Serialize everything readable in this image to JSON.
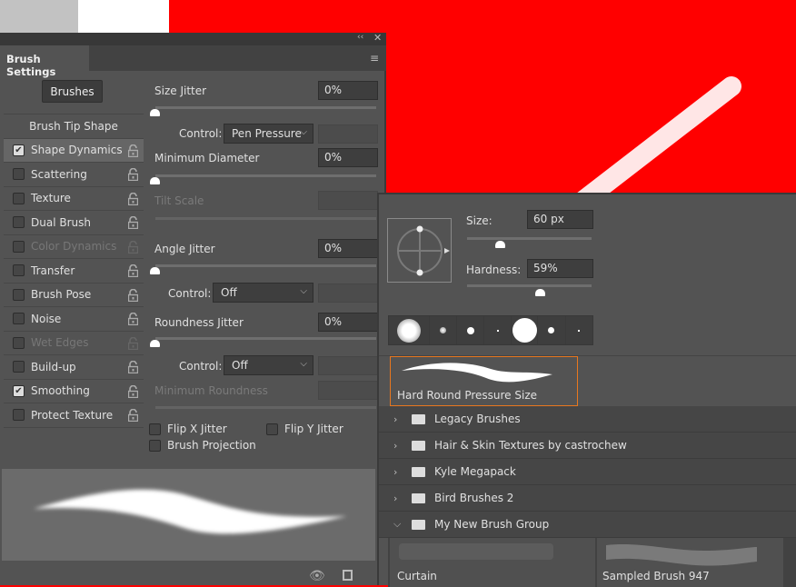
{
  "canvas": {
    "bg": "#ff0000"
  },
  "brush_settings": {
    "title": "Brush Settings",
    "brushes_button": "Brushes",
    "tip_shape": "Brush Tip Shape",
    "items": [
      {
        "label": "Shape Dynamics",
        "checked": true,
        "enabled": true,
        "selected": true
      },
      {
        "label": "Scattering",
        "checked": false,
        "enabled": true
      },
      {
        "label": "Texture",
        "checked": false,
        "enabled": true
      },
      {
        "label": "Dual Brush",
        "checked": false,
        "enabled": true
      },
      {
        "label": "Color Dynamics",
        "checked": false,
        "enabled": false
      },
      {
        "label": "Transfer",
        "checked": false,
        "enabled": true
      },
      {
        "label": "Brush Pose",
        "checked": false,
        "enabled": true
      },
      {
        "label": "Noise",
        "checked": false,
        "enabled": true
      },
      {
        "label": "Wet Edges",
        "checked": false,
        "enabled": false
      },
      {
        "label": "Build-up",
        "checked": false,
        "enabled": true
      },
      {
        "label": "Smoothing",
        "checked": true,
        "enabled": true
      },
      {
        "label": "Protect Texture",
        "checked": false,
        "enabled": true
      }
    ],
    "size_jitter": {
      "label": "Size Jitter",
      "value": "0%",
      "control_label": "Control:",
      "control": "Pen Pressure"
    },
    "min_diameter": {
      "label": "Minimum Diameter",
      "value": "0%"
    },
    "tilt_scale": {
      "label": "Tilt Scale"
    },
    "angle_jitter": {
      "label": "Angle Jitter",
      "value": "0%",
      "control_label": "Control:",
      "control": "Off"
    },
    "roundness_jitter": {
      "label": "Roundness Jitter",
      "value": "0%",
      "control_label": "Control:",
      "control": "Off"
    },
    "min_roundness": {
      "label": "Minimum Roundness"
    },
    "flip_x": "Flip X Jitter",
    "flip_y": "Flip Y Jitter",
    "projection": "Brush Projection"
  },
  "brushes_panel": {
    "size_label": "Size:",
    "size": "60 px",
    "size_fraction": 0.2,
    "hardness_label": "Hardness:",
    "hardness": "59%",
    "hardness_fraction": 0.59,
    "selected_brush": "Hard Round Pressure Size",
    "groups": [
      "Legacy Brushes",
      "Hair & Skin Textures by castrochew",
      "Kyle Megapack",
      "Bird Brushes 2",
      "My New Brush Group"
    ],
    "group_brushes": [
      "Curtain",
      "Sampled Brush 947"
    ],
    "accent": "#e8771e"
  }
}
